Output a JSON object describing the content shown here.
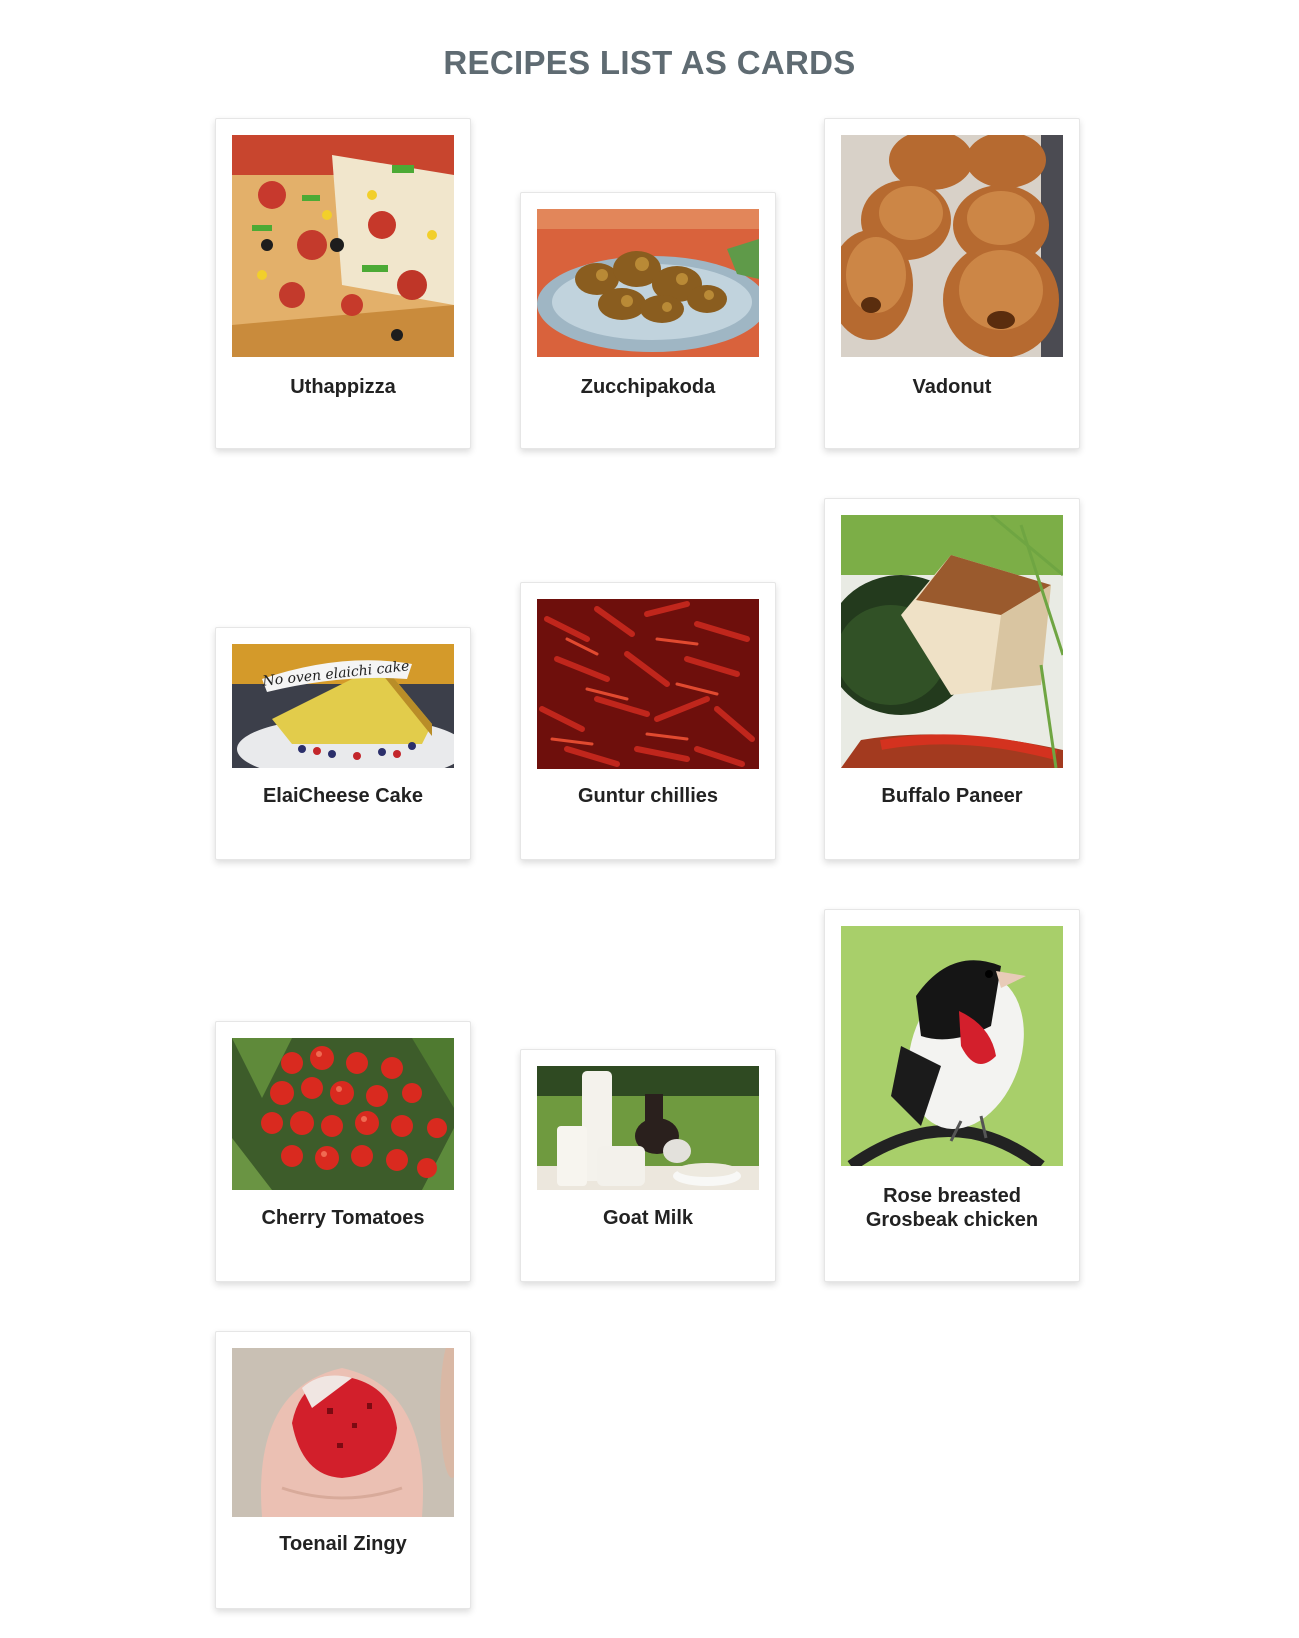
{
  "page": {
    "title": "RECIPES LIST AS CARDS"
  },
  "recipes": [
    {
      "name": "Uthappizza",
      "image": "pizza-photo"
    },
    {
      "name": "Zucchipakoda",
      "image": "pakoda-photo"
    },
    {
      "name": "Vadonut",
      "image": "donut-photo"
    },
    {
      "name": "ElaiCheese Cake",
      "image": "cake-photo",
      "image_caption": "No oven elaichi cake"
    },
    {
      "name": "Guntur chillies",
      "image": "chillies-photo"
    },
    {
      "name": "Buffalo Paneer",
      "image": "paneer-photo"
    },
    {
      "name": "Cherry Tomatoes",
      "image": "tomatoes-photo"
    },
    {
      "name": "Goat Milk",
      "image": "goat-milk-photo"
    },
    {
      "name": "Rose breasted Grosbeak chicken",
      "image": "grosbeak-photo"
    },
    {
      "name": "Toenail Zingy",
      "image": "toenail-photo"
    }
  ]
}
